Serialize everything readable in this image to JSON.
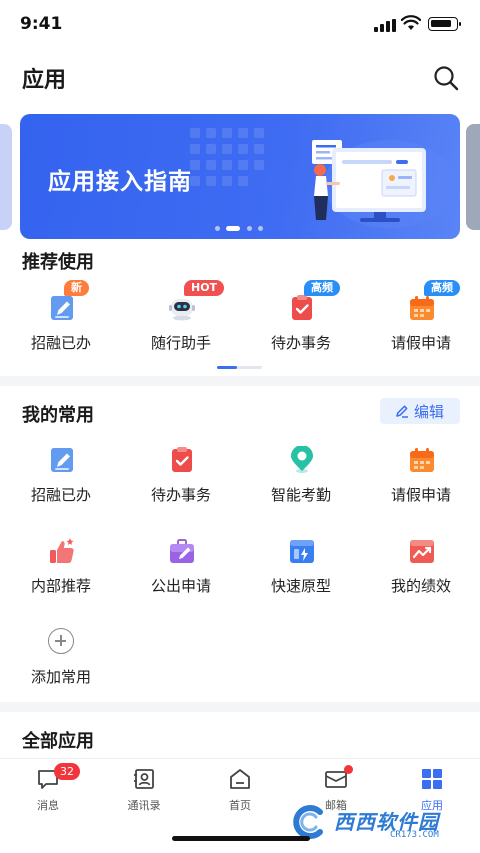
{
  "status_bar": {
    "time": "9:41"
  },
  "header": {
    "title": "应用"
  },
  "banner": {
    "title": "应用接入指南",
    "page_count": 4,
    "active_page": 2
  },
  "recommended": {
    "title": "推荐使用",
    "items": [
      {
        "label": "招融已办",
        "tag": "新",
        "icon": "pen-doc-icon"
      },
      {
        "label": "随行助手",
        "tag": "HOT",
        "icon": "robot-icon"
      },
      {
        "label": "待办事务",
        "tag": "高频",
        "icon": "todo-check-icon"
      },
      {
        "label": "请假申请",
        "tag": "高频",
        "icon": "calendar-icon"
      }
    ]
  },
  "frequent": {
    "title": "我的常用",
    "edit_label": "编辑",
    "items": [
      {
        "label": "招融已办",
        "icon": "pen-doc-icon"
      },
      {
        "label": "待办事务",
        "icon": "todo-check-icon"
      },
      {
        "label": "智能考勤",
        "icon": "location-pin-icon"
      },
      {
        "label": "请假申请",
        "icon": "calendar-icon"
      },
      {
        "label": "内部推荐",
        "icon": "thumbs-up-icon"
      },
      {
        "label": "公出申请",
        "icon": "briefcase-icon"
      },
      {
        "label": "快速原型",
        "icon": "lightning-doc-icon"
      },
      {
        "label": "我的绩效",
        "icon": "chart-doc-icon"
      }
    ],
    "add_label": "添加常用"
  },
  "all_apps": {
    "title": "全部应用"
  },
  "tab_bar": {
    "tabs": [
      {
        "label": "消息",
        "badge": "32",
        "icon": "message-icon"
      },
      {
        "label": "通讯录",
        "icon": "contacts-icon"
      },
      {
        "label": "首页",
        "icon": "home-icon"
      },
      {
        "label": "邮箱",
        "icon": "mail-icon"
      },
      {
        "label": "应用",
        "icon": "apps-grid-icon",
        "active": true
      }
    ]
  },
  "watermark": {
    "text": "西西软件园",
    "sub": "CR173.COM"
  },
  "colors": {
    "accent": "#3b6ef0",
    "banner": "#3463ef",
    "badge": "#f2353a"
  }
}
